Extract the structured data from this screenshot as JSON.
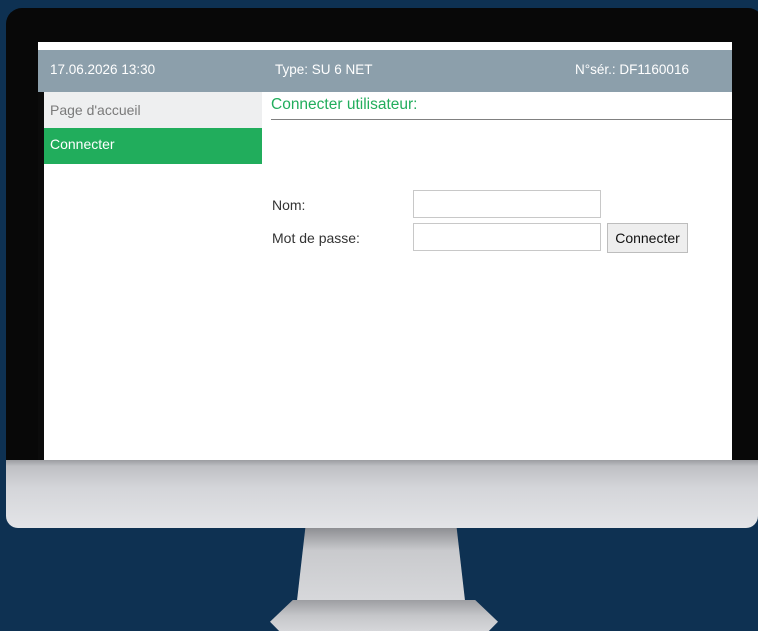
{
  "header": {
    "datetime": "17.06.2026 13:30",
    "type": "Type: SU 6 NET",
    "serial": "N°sér.: DF1160016"
  },
  "sidebar": {
    "items": [
      {
        "label": "Page d'accueil",
        "active": false
      },
      {
        "label": "Connecter",
        "active": true
      }
    ]
  },
  "main": {
    "title": "Connecter utilisateur:",
    "form": {
      "name_label": "Nom:",
      "name_value": "",
      "password_label": "Mot de passe:",
      "password_value": "",
      "submit_label": "Connecter"
    }
  },
  "colors": {
    "accent": "#21ad5c",
    "header_bg": "#8c9fab",
    "background": "#0e3152"
  }
}
